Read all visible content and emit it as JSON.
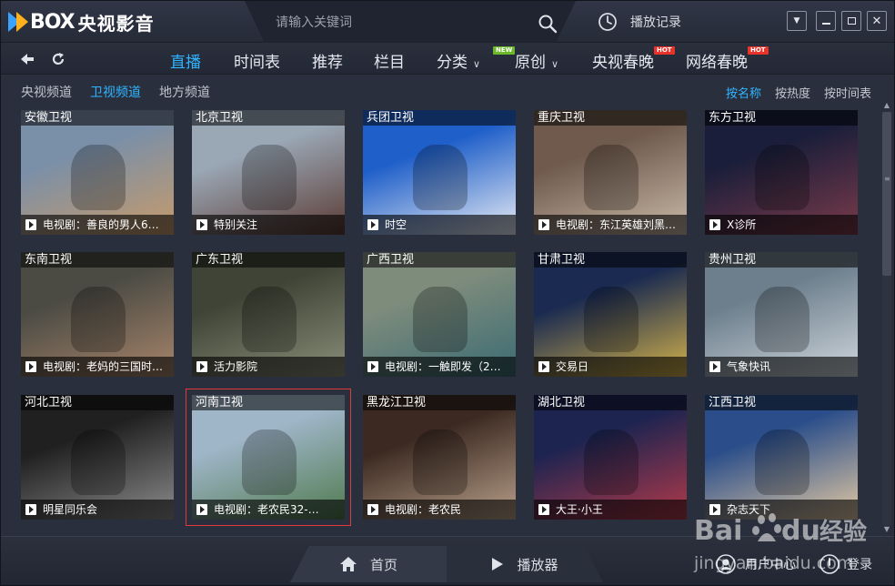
{
  "app": {
    "logo_text": "BOX",
    "logo_cn": "央视影音",
    "search_placeholder": "请输入关键词",
    "history_label": "播放记录"
  },
  "nav": {
    "items": [
      {
        "label": "直播",
        "active": true
      },
      {
        "label": "时间表"
      },
      {
        "label": "推荐"
      },
      {
        "label": "栏目"
      },
      {
        "label": "分类",
        "dropdown": true,
        "badge": "NEW"
      },
      {
        "label": "原创",
        "dropdown": true
      },
      {
        "label": "央视春晚",
        "badge": "HOT"
      },
      {
        "label": "网络春晚",
        "badge": "HOT"
      }
    ]
  },
  "subtabs": [
    {
      "label": "央视频道"
    },
    {
      "label": "卫视频道",
      "active": true
    },
    {
      "label": "地方频道"
    }
  ],
  "sort": [
    {
      "label": "按名称",
      "active": true
    },
    {
      "label": "按热度"
    },
    {
      "label": "按时间表"
    }
  ],
  "channels": [
    {
      "name": "安徽卫视",
      "program": "电视剧：善良的男人6…",
      "colors": [
        "#7a8fa8",
        "#c79b6a"
      ]
    },
    {
      "name": "北京卫视",
      "program": "特别关注",
      "colors": [
        "#9aa7b5",
        "#5b3b34"
      ]
    },
    {
      "name": "兵团卫视",
      "program": "时空",
      "colors": [
        "#1f5fc9",
        "#e8ecf4"
      ]
    },
    {
      "name": "重庆卫视",
      "program": "电视剧：东江英雄刘黑…",
      "colors": [
        "#6f5a4d",
        "#c9b9a8"
      ]
    },
    {
      "name": "东方卫视",
      "program": "X诊所",
      "colors": [
        "#1b1e3a",
        "#7b3b4a"
      ]
    },
    {
      "name": "东南卫视",
      "program": "电视剧：老妈的三国时…",
      "colors": [
        "#4b4b44",
        "#a8856b"
      ]
    },
    {
      "name": "广东卫视",
      "program": "活力影院",
      "colors": [
        "#3f4436",
        "#8a8f7a"
      ]
    },
    {
      "name": "广西卫视",
      "program": "电视剧：一触即发（2…",
      "colors": [
        "#7e8c7c",
        "#3b6b73"
      ]
    },
    {
      "name": "甘肃卫视",
      "program": "交易日",
      "colors": [
        "#1a2a50",
        "#d4b24a"
      ]
    },
    {
      "name": "贵州卫视",
      "program": "气象快讯",
      "colors": [
        "#6d7f8d",
        "#cfd6dc"
      ]
    },
    {
      "name": "河北卫视",
      "program": "明星同乐会",
      "colors": [
        "#202020",
        "#8c8c8c"
      ]
    },
    {
      "name": "河南卫视",
      "program": "电视剧：老农民32-…",
      "colors": [
        "#9fb5c8",
        "#4f7a4d"
      ],
      "selected": true
    },
    {
      "name": "黑龙江卫视",
      "program": "电视剧：老农民",
      "colors": [
        "#3c2a22",
        "#b9a08a"
      ]
    },
    {
      "name": "湖北卫视",
      "program": "大王·小王",
      "colors": [
        "#1d2450",
        "#b33a4a"
      ]
    },
    {
      "name": "江西卫视",
      "program": "杂志天下",
      "colors": [
        "#2b4e8a",
        "#e2c9a3"
      ]
    }
  ],
  "bottom": {
    "home_label": "首页",
    "player_label": "播放器",
    "user_center_label": "用户中心",
    "login_label": "登录"
  },
  "watermark": {
    "brand": "Bai du 经验",
    "url": "jingyan.baidu.com"
  },
  "colors": {
    "accent": "#2fb5ff",
    "badge_new": "#6bb82a",
    "badge_hot": "#e8322a",
    "selected_outline": "#e03a3a"
  }
}
